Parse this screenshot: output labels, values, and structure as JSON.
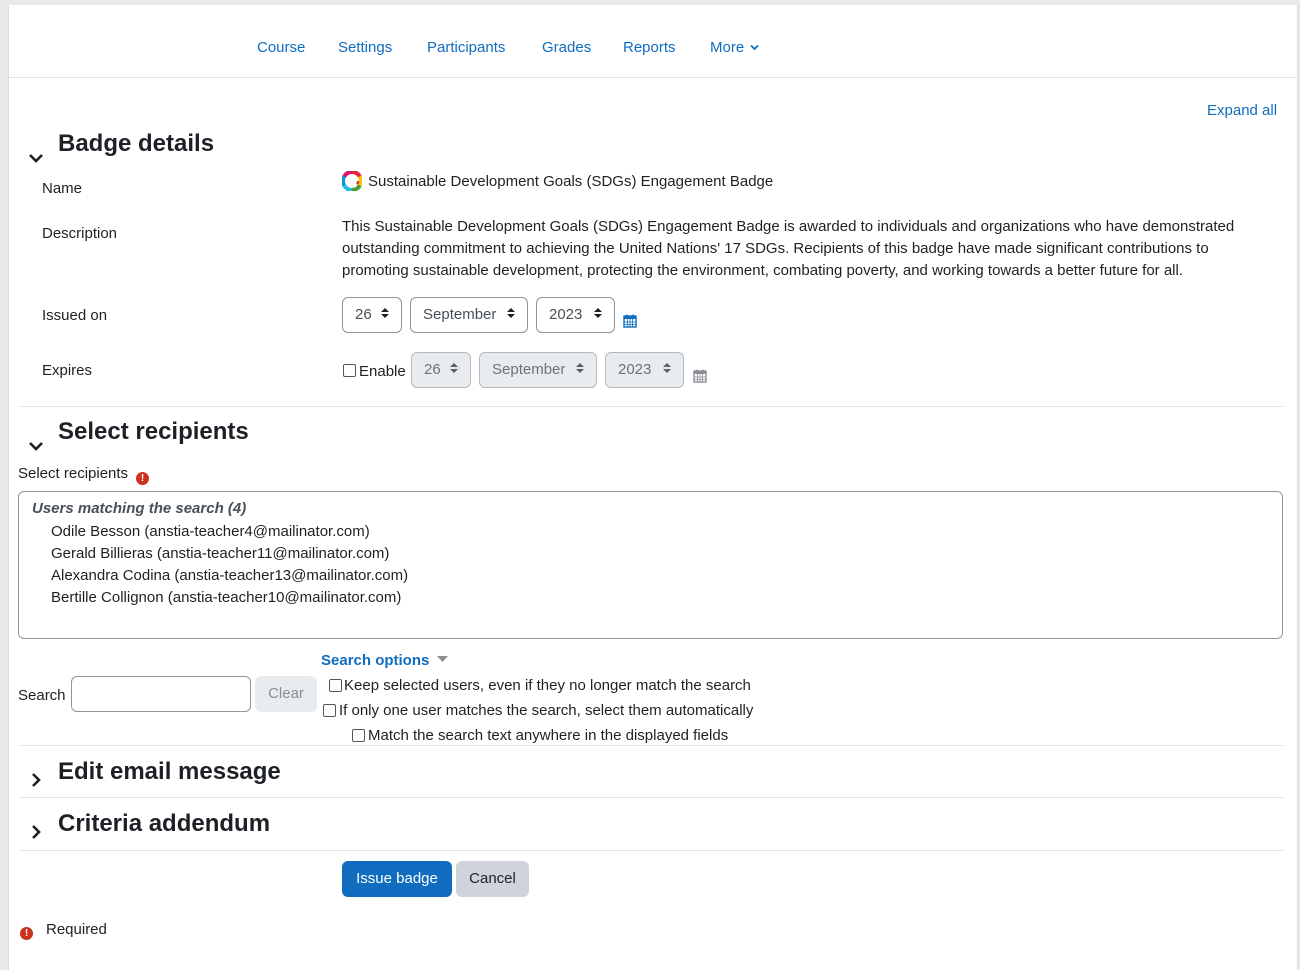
{
  "nav": {
    "items": [
      "Course",
      "Settings",
      "Participants",
      "Grades",
      "Reports",
      "More"
    ]
  },
  "expand_all": "Expand all",
  "badge_details": {
    "title": "Badge details",
    "name_label": "Name",
    "name_value": "Sustainable Development Goals (SDGs) Engagement Badge",
    "description_label": "Description",
    "description_lines": [
      "This Sustainable Development Goals (SDGs) Engagement Badge is awarded to individuals and organizations who have demonstrated",
      "outstanding commitment to achieving the United Nations' 17 SDGs. Recipients of this badge have made significant contributions to",
      "promoting sustainable development, protecting the environment, combating poverty, and working towards a better future for all."
    ],
    "issued_label": "Issued on",
    "issued": {
      "day": "26",
      "month": "September",
      "year": "2023"
    },
    "expires_label": "Expires",
    "enable_label": "Enable",
    "expires": {
      "day": "26",
      "month": "September",
      "year": "2023"
    }
  },
  "recipients": {
    "title": "Select recipients",
    "field_label": "Select recipients",
    "group_label": "Users matching the search (4)",
    "users": [
      "Odile Besson (anstia-teacher4@mailinator.com)",
      "Gerald Billieras (anstia-teacher11@mailinator.com)",
      "Alexandra Codina (anstia-teacher13@mailinator.com)",
      "Bertille Collignon (anstia-teacher10@mailinator.com)"
    ],
    "search_options_label": "Search options",
    "search_label": "Search",
    "search_value": "",
    "clear_label": "Clear",
    "options": [
      "Keep selected users, even if they no longer match the search",
      "If only one user matches the search, select them automatically",
      "Match the search text anywhere in the displayed fields"
    ]
  },
  "edit_email": {
    "title": "Edit email message"
  },
  "criteria": {
    "title": "Criteria addendum"
  },
  "buttons": {
    "issue": "Issue badge",
    "cancel": "Cancel"
  },
  "required_label": "Required",
  "colors": {
    "accent": "#0f6cbf",
    "required": "#ca3120",
    "secondary_btn": "#ced4da"
  }
}
